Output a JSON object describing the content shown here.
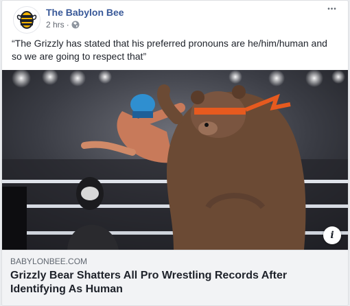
{
  "post": {
    "page_name": "The Babylon Bee",
    "timestamp": "2 hrs",
    "separator": "·",
    "privacy_icon": "globe-icon",
    "more_icon": "more-dots-icon",
    "more_label": "•••",
    "text": "“The Grizzly has stated that his preferred pronouns are he/him/human and so we are going to respect that”"
  },
  "link_preview": {
    "domain": "BABYLONBEE.COM",
    "title": "Grizzly Bear Shatters All Pro Wrestling Records After Identifying As Human",
    "info_label": "i"
  },
  "colors": {
    "page_link": "#385898",
    "secondary_text": "#606770",
    "logo_yellow": "#f5b400"
  }
}
